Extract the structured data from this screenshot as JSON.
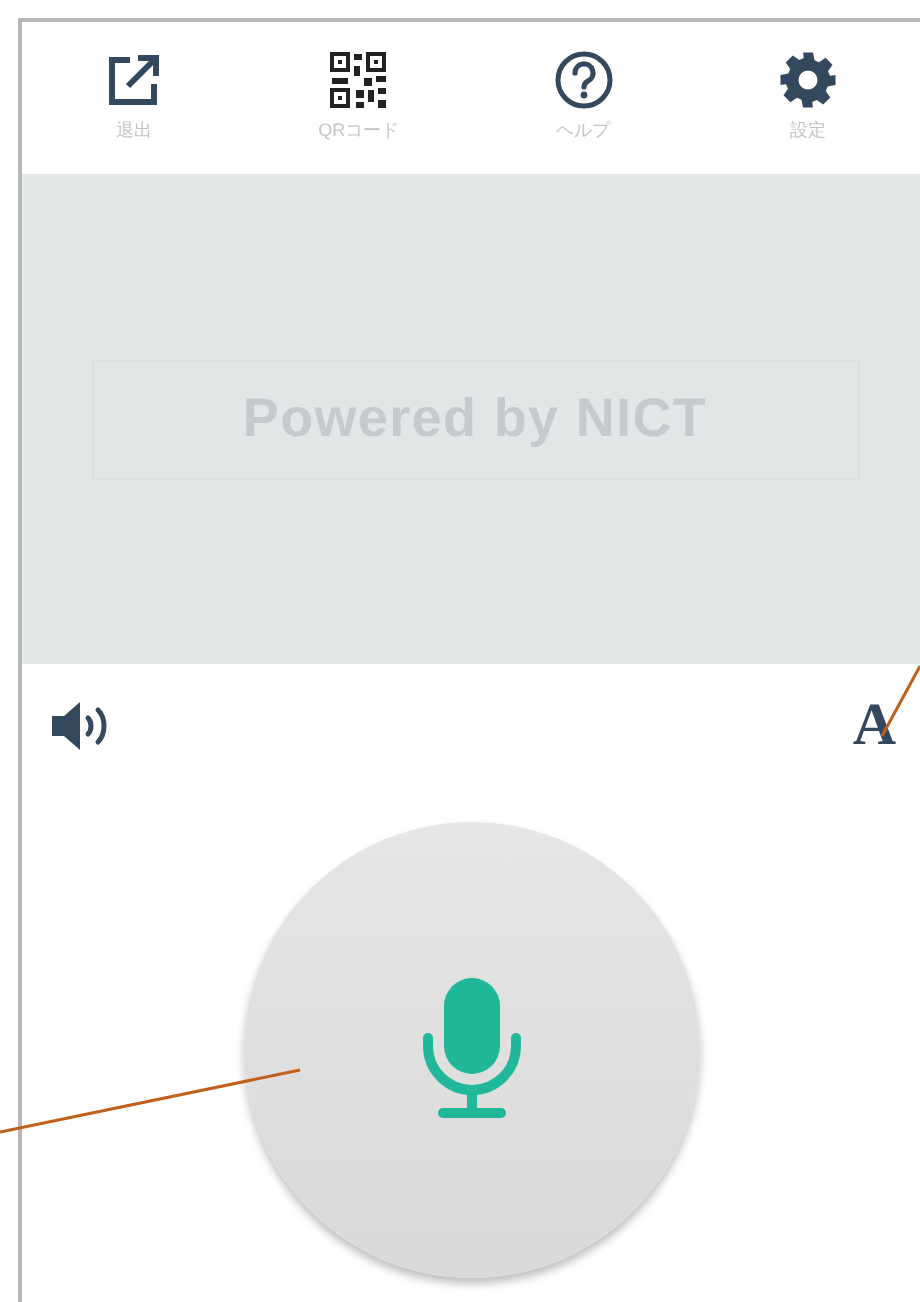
{
  "toolbar": [
    {
      "kind": "exit",
      "label": "退出"
    },
    {
      "kind": "qr",
      "label": "QRコード"
    },
    {
      "kind": "help",
      "label": "ヘルプ"
    },
    {
      "kind": "settings",
      "label": "設定"
    }
  ],
  "display": {
    "text": "Powered by NICT"
  },
  "controls": {
    "font_button": "A"
  }
}
